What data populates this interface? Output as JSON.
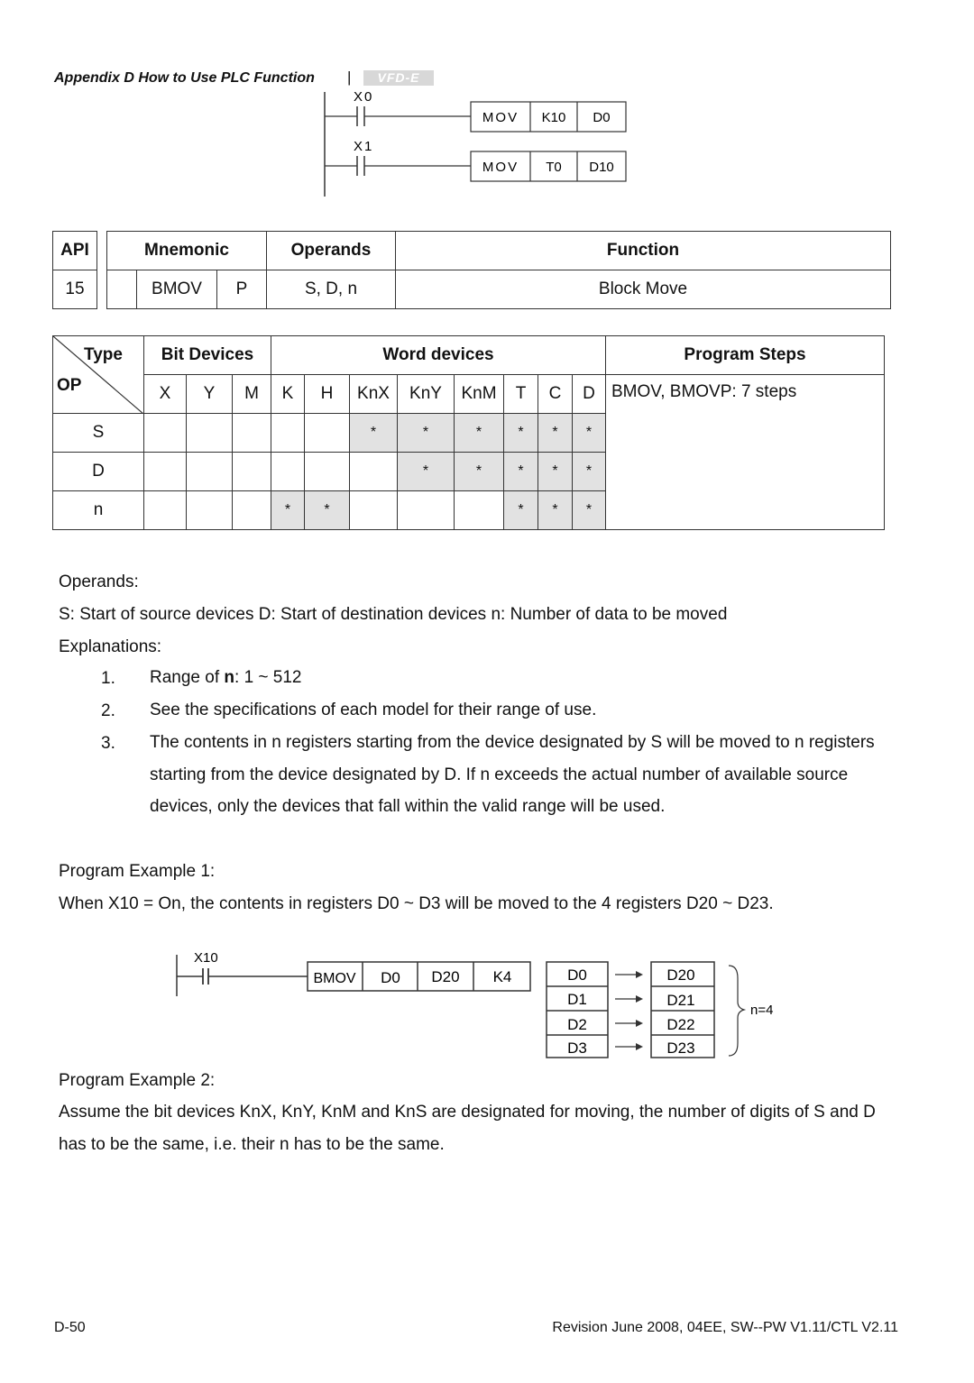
{
  "header": {
    "title": "Appendix D How to Use PLC Function",
    "separator": "|",
    "logo_text": "VFD-E"
  },
  "ladder_top": {
    "rungs": [
      {
        "contact": "X0",
        "instruction": [
          "MOV",
          "K10",
          "D0"
        ]
      },
      {
        "contact": "X1",
        "instruction": [
          "MOV",
          "T0",
          "D10"
        ]
      }
    ]
  },
  "api_table": {
    "headers": {
      "api": "API",
      "mnemonic": "Mnemonic",
      "operands": "Operands",
      "function": "Function"
    },
    "row": {
      "api": "15",
      "prefix": "",
      "mnemonic": "BMOV",
      "pulse": "P",
      "operands": "S, D, n",
      "function": "Block Move"
    }
  },
  "op_table": {
    "corner_type": "Type",
    "corner_op": "OP",
    "groups": {
      "bit": "Bit Devices",
      "word": "Word devices",
      "steps": "Program Steps"
    },
    "columns": [
      "X",
      "Y",
      "M",
      "K",
      "H",
      "KnX",
      "KnY",
      "KnM",
      "T",
      "C",
      "D"
    ],
    "program_steps": "BMOV, BMOVP: 7 steps",
    "rows": [
      {
        "op": "S",
        "cells": [
          "",
          "",
          "",
          "",
          "",
          "*",
          "*",
          "*",
          "*",
          "*",
          "*"
        ]
      },
      {
        "op": "D",
        "cells": [
          "",
          "",
          "",
          "",
          "",
          "",
          "*",
          "*",
          "*",
          "*",
          "*"
        ]
      },
      {
        "op": "n",
        "cells": [
          "",
          "",
          "",
          "*",
          "*",
          "",
          "",
          "",
          "*",
          "*",
          "*"
        ]
      }
    ]
  },
  "operands_section": {
    "heading": "Operands:",
    "line": "S: Start of source devices  D: Start of destination devices  n: Number of data to be moved"
  },
  "explanations": {
    "heading": "Explanations:",
    "items": [
      {
        "num": "1.",
        "text_prefix": "Range of ",
        "text_bold": "n",
        "text_suffix": ": 1 ~ 512"
      },
      {
        "num": "2.",
        "text": "See the specifications of each model for their range of use."
      },
      {
        "num": "3.",
        "text": "The contents in n registers starting from the device designated by S will be moved to n registers starting from the device designated by D. If n exceeds the actual number of available source devices, only the devices that fall within the valid range will be used."
      }
    ]
  },
  "example1": {
    "heading": "Program Example 1:",
    "text": "When X10 = On, the contents in registers D0 ~ D3 will be moved to the 4 registers D20 ~ D23.",
    "contact": "X10",
    "instruction": [
      "BMOV",
      "D0",
      "D20",
      "K4"
    ],
    "source": [
      "D0",
      "D1",
      "D2",
      "D3"
    ],
    "dest": [
      "D20",
      "D21",
      "D22",
      "D23"
    ],
    "brace_label": "n=4"
  },
  "example2": {
    "heading": "Program Example 2:",
    "text": "Assume the bit devices KnX, KnY, KnM and KnS are designated for moving, the number of digits of S and D has to be the same, i.e. their n has to be the same."
  },
  "footer": {
    "page": "D-50",
    "revision": "Revision June 2008, 04EE, SW--PW V1.11/CTL V2.11"
  }
}
